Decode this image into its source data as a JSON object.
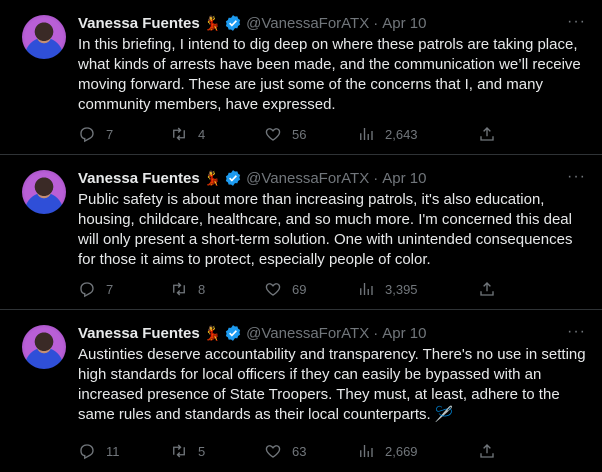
{
  "tweets": [
    {
      "author": "Vanessa Fuentes",
      "emoji": "💃",
      "handle": "@VanessaForATX",
      "dot": "·",
      "date": "Apr 10",
      "more": "···",
      "text": "In this briefing, I intend to dig deep on where these patrols are taking place, what kinds of arrests have been made, and the communication we’ll receive moving forward. These are just some of the concerns that I, and many community members, have expressed.",
      "replies": "7",
      "retweets": "4",
      "likes": "56",
      "views": "2,643"
    },
    {
      "author": "Vanessa Fuentes",
      "emoji": "💃",
      "handle": "@VanessaForATX",
      "dot": "·",
      "date": "Apr 10",
      "more": "···",
      "text": "Public safety is about more than increasing patrols, it's also education, housing, childcare, healthcare, and so much more. I'm concerned this deal will only present a short-term solution. One with unintended consequences for those it aims to protect, especially people of color.",
      "replies": "7",
      "retweets": "8",
      "likes": "69",
      "views": "3,395"
    },
    {
      "author": "Vanessa Fuentes",
      "emoji": "💃",
      "handle": "@VanessaForATX",
      "dot": "·",
      "date": "Apr 10",
      "more": "···",
      "text": "Austinties deserve accountability and transparency. There's no use in setting high standards for local officers if they can easily be bypassed with an increased presence of State Troopers. They must, at least, adhere to the same rules and standards as their local counterparts. 🪡",
      "replies": "11",
      "retweets": "5",
      "likes": "63",
      "views": "2,669"
    }
  ],
  "colors": {
    "background": "#000000",
    "text": "#e7e9ea",
    "muted": "#71767b",
    "verified": "#1d9bf0"
  },
  "icons": [
    "verified-badge-icon",
    "more-icon",
    "reply-icon",
    "retweet-icon",
    "like-icon",
    "views-icon",
    "share-icon"
  ]
}
